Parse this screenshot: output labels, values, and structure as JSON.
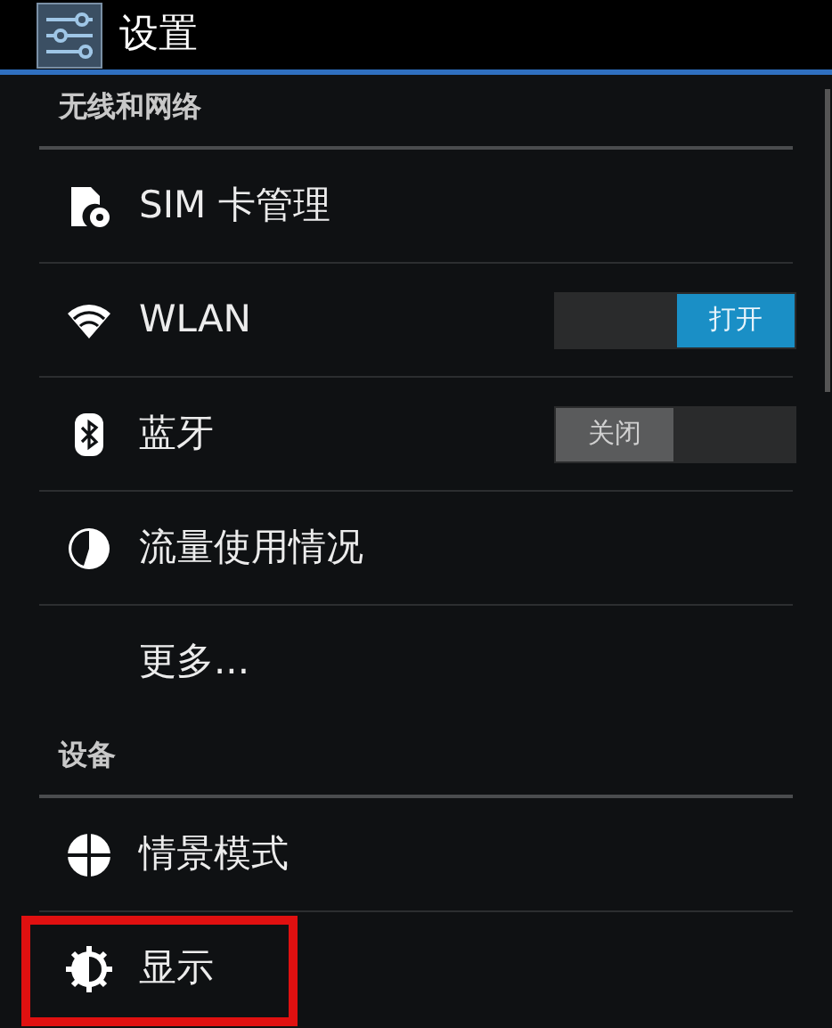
{
  "action_bar": {
    "title": "设置"
  },
  "sections": [
    {
      "header": "无线和网络",
      "items": [
        {
          "kind": "sim",
          "label": "SIM 卡管理",
          "highlighted": false
        },
        {
          "kind": "wifi",
          "label": "WLAN",
          "highlighted": false,
          "switch": {
            "on": true,
            "text": "打开"
          }
        },
        {
          "kind": "bluetooth",
          "label": "蓝牙",
          "highlighted": false,
          "switch": {
            "on": false,
            "text": "关闭"
          }
        },
        {
          "kind": "data",
          "label": "流量使用情况",
          "highlighted": false
        },
        {
          "kind": "text",
          "label": "更多...",
          "highlighted": false
        }
      ]
    },
    {
      "header": "设备",
      "items": [
        {
          "kind": "profile",
          "label": "情景模式",
          "highlighted": false
        },
        {
          "kind": "display",
          "label": "显示",
          "highlighted": true
        }
      ]
    }
  ]
}
